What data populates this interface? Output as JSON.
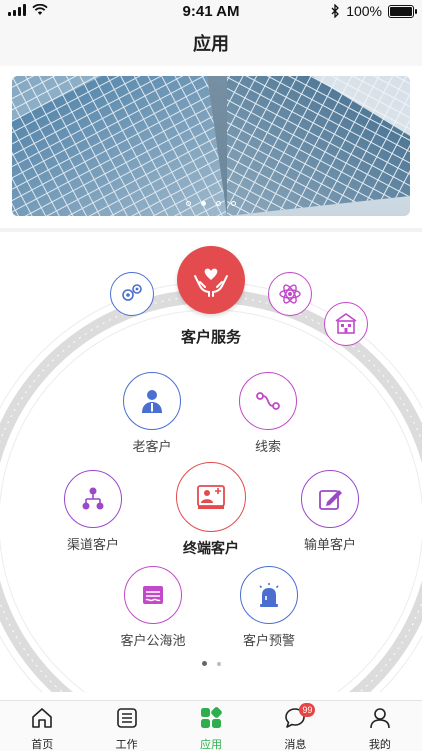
{
  "status_bar": {
    "time": "9:41 AM",
    "battery": "100%"
  },
  "header": {
    "title": "应用"
  },
  "banner": {
    "dots": 4,
    "active_dot": 2
  },
  "hero": {
    "label": "客户服务",
    "icon": "heart-hands-icon",
    "color": "#e34b4e"
  },
  "orbit_icons": [
    {
      "name": "gears-icon",
      "color": "#4a6fd1"
    },
    {
      "name": "atom-icon",
      "color": "#c249c9"
    },
    {
      "name": "building-icon",
      "color": "#c249c9"
    }
  ],
  "apps": [
    {
      "label": "老客户",
      "icon": "person-icon",
      "color": "#4a6fd1"
    },
    {
      "label": "线索",
      "icon": "route-icon",
      "color": "#c249c9"
    },
    {
      "label": "渠道客户",
      "icon": "hierarchy-icon",
      "color": "#9b49c9"
    },
    {
      "label": "终端客户",
      "icon": "terminal-icon",
      "color": "#e34b4e"
    },
    {
      "label": "输单客户",
      "icon": "edit-icon",
      "color": "#9b49c9"
    },
    {
      "label": "客户公海池",
      "icon": "pool-icon",
      "color": "#c249c9"
    },
    {
      "label": "客户预警",
      "icon": "alarm-icon",
      "color": "#4a6fd1"
    }
  ],
  "tabs": [
    {
      "label": "首页",
      "icon": "home-icon"
    },
    {
      "label": "工作",
      "icon": "list-icon"
    },
    {
      "label": "应用",
      "icon": "apps-icon",
      "active": true
    },
    {
      "label": "消息",
      "icon": "chat-icon",
      "badge": "99"
    },
    {
      "label": "我的",
      "icon": "user-icon"
    }
  ],
  "colors": {
    "accent": "#2fae4f",
    "badge": "#e54545"
  }
}
